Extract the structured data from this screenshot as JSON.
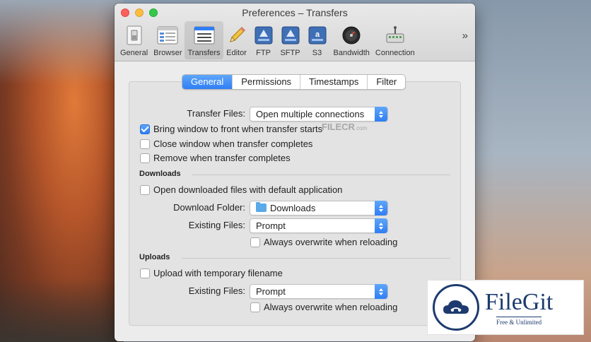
{
  "window": {
    "title": "Preferences – Transfers"
  },
  "toolbar": {
    "items": [
      {
        "label": "General",
        "icon": "switch-icon"
      },
      {
        "label": "Browser",
        "icon": "browser-window-icon"
      },
      {
        "label": "Transfers",
        "icon": "transfers-list-icon",
        "active": true
      },
      {
        "label": "Editor",
        "icon": "pencil-icon"
      },
      {
        "label": "FTP",
        "icon": "ftp-drive-icon"
      },
      {
        "label": "SFTP",
        "icon": "sftp-drive-icon"
      },
      {
        "label": "S3",
        "icon": "s3-drive-icon"
      },
      {
        "label": "Bandwidth",
        "icon": "bandwidth-gauge-icon"
      },
      {
        "label": "Connection",
        "icon": "connection-icon"
      }
    ],
    "overflow": "»"
  },
  "tabs": [
    {
      "label": "General",
      "active": true
    },
    {
      "label": "Permissions"
    },
    {
      "label": "Timestamps"
    },
    {
      "label": "Filter"
    }
  ],
  "general": {
    "transfer_files_label": "Transfer Files:",
    "transfer_files_value": "Open multiple connections",
    "bring_to_front": {
      "label": "Bring window to front when transfer starts",
      "checked": true
    },
    "close_window": {
      "label": "Close window when transfer completes",
      "checked": false
    },
    "remove_when_complete": {
      "label": "Remove when transfer completes",
      "checked": false
    }
  },
  "downloads": {
    "heading": "Downloads",
    "open_default": {
      "label": "Open downloaded files with default application",
      "checked": false
    },
    "folder_label": "Download Folder:",
    "folder_value": "Downloads",
    "existing_label": "Existing Files:",
    "existing_value": "Prompt",
    "always_overwrite": {
      "label": "Always overwrite when reloading",
      "checked": false
    }
  },
  "uploads": {
    "heading": "Uploads",
    "temp_filename": {
      "label": "Upload with temporary filename",
      "checked": false
    },
    "existing_label": "Existing Files:",
    "existing_value": "Prompt",
    "always_overwrite": {
      "label": "Always overwrite when reloading",
      "checked": false
    }
  },
  "watermark": {
    "text": "FILECR",
    "suffix": ".com"
  },
  "badge": {
    "name": "FileGit",
    "tagline": "Free & Unlimited"
  },
  "colors": {
    "accent": "#2f7ef5",
    "badge_navy": "#1d3b6e"
  }
}
